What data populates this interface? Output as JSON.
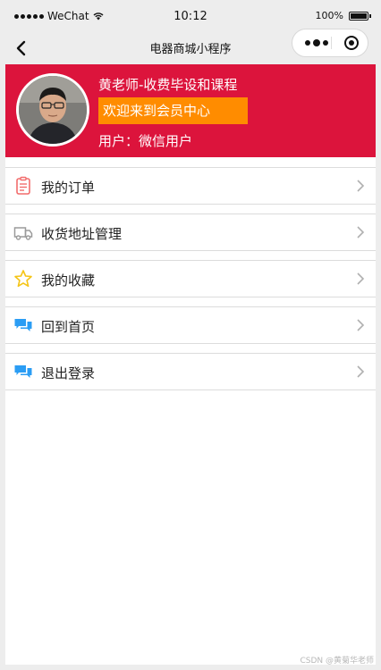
{
  "status_bar": {
    "carrier": "WeChat",
    "time": "10:12",
    "battery": "100%"
  },
  "navbar": {
    "title": "电器商城小程序"
  },
  "profile": {
    "name": "黄老师-收费毕设和课程",
    "welcome": "欢迎来到会员中心",
    "user": "用户：微信用户"
  },
  "menu": [
    {
      "label": "我的订单",
      "icon": "order-icon",
      "color": "#f26d6d"
    },
    {
      "label": "收货地址管理",
      "icon": "truck-icon",
      "color": "#9a9a9a"
    },
    {
      "label": "我的收藏",
      "icon": "star-icon",
      "color": "#f5c518"
    },
    {
      "label": "回到首页",
      "icon": "chat-icon",
      "color": "#2b9df4"
    },
    {
      "label": "退出登录",
      "icon": "chat-icon",
      "color": "#2b9df4"
    }
  ],
  "colors": {
    "header": "#dc143c",
    "welcome_bg": "#ff8c00",
    "page_bg": "#ededed"
  },
  "watermark": "CSDN @黄菊华老师"
}
